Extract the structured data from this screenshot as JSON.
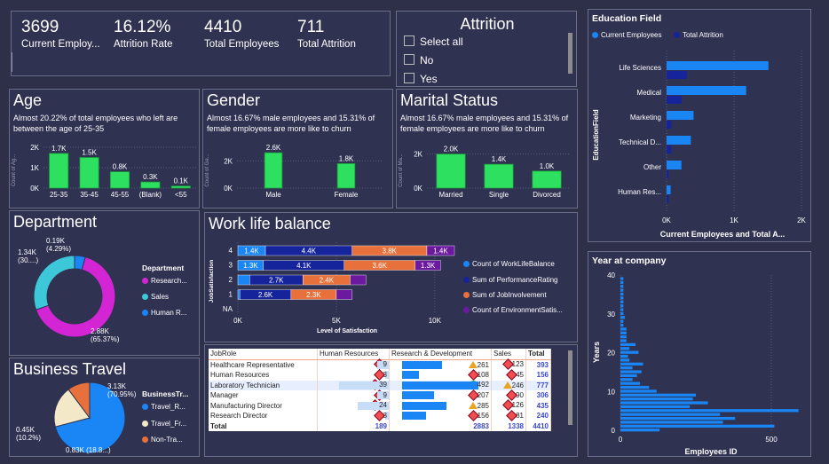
{
  "kpis": [
    {
      "value": "3699",
      "label": "Current Employ..."
    },
    {
      "value": "16.12%",
      "label": "Attrition Rate"
    },
    {
      "value": "4410",
      "label": "Total Employees"
    },
    {
      "value": "711",
      "label": "Total Attrition"
    }
  ],
  "attrition_filter": {
    "title": "Attrition",
    "options": [
      "Select all",
      "No",
      "Yes"
    ]
  },
  "age": {
    "title": "Age",
    "subtitle": "Almost 20.22% of total employees who left are between the age of 25-35",
    "ylabel": "Count of Ag..."
  },
  "gender": {
    "title": "Gender",
    "subtitle": "Almost 16.67% male employees and 15.31% of female employees are more like to churn",
    "ylabel": "Count of Ge..."
  },
  "marital": {
    "title": "Marital Status",
    "subtitle": "Almost 16.67% male employees and 15.31% of female employees are more like to churn",
    "ylabel": "Count of Ma..."
  },
  "department": {
    "title": "Department",
    "legend_title": "Department",
    "legend": [
      "Research...",
      "Sales",
      "Human R..."
    ],
    "labels": [
      "0.19K (4.29%)",
      "1.34K (30....)",
      "2.88K (65.37%)"
    ]
  },
  "travel": {
    "title": "Business Travel",
    "legend_title": "BusinessTr...",
    "legend": [
      "Travel_R...",
      "Travel_Fr...",
      "Non-Tra..."
    ],
    "labels": [
      "3.13K (70.95%)",
      "0.45K (10.2%)",
      "0.83K (18.8...)"
    ]
  },
  "wlb": {
    "title": "Work life balance",
    "ylabel": "JobSatisfaction",
    "xlabel": "Level of Satisfaction",
    "legend": [
      "Count of WorkLifeBalance",
      "Sum of PerformanceRating",
      "Sum of JobInvolvement",
      "Count of EnvironmentSatis..."
    ]
  },
  "education": {
    "title": "Education Field",
    "legend": [
      "Current Employees",
      "Total Attrition"
    ],
    "ylabel": "EducationField",
    "xlabel": "Current Employees and Total A..."
  },
  "years": {
    "title": "Year at company",
    "ylabel": "Years",
    "xlabel": "Employees ID"
  },
  "jobrole": {
    "headers": [
      "JobRole",
      "Human Resources",
      "Research & Development",
      "Sales",
      "Total"
    ],
    "rows": [
      [
        "Healthcare Representative",
        "9",
        "261",
        "123",
        "393"
      ],
      [
        "Human Resources",
        "3",
        "108",
        "45",
        "156"
      ],
      [
        "Laboratory Technician",
        "39",
        "492",
        "246",
        "777"
      ],
      [
        "Manager",
        "9",
        "207",
        "90",
        "306"
      ],
      [
        "Manufacturing Director",
        "24",
        "285",
        "126",
        "435"
      ],
      [
        "Research Director",
        "3",
        "156",
        "81",
        "240"
      ]
    ],
    "total": [
      "Total",
      "189",
      "2883",
      "1338",
      "4410"
    ]
  },
  "colors": {
    "green": "#2ee05f",
    "blue": "#1a85f5",
    "navy": "#15249a",
    "orange": "#e8703a",
    "purple": "#6b1aa0",
    "magenta": "#d425d4",
    "teal": "#3cc8d8",
    "cream": "#f3e9c9"
  },
  "chart_data": [
    {
      "type": "bar",
      "title": "Age",
      "categories": [
        "25-35",
        "35-45",
        "45-55",
        "(Blank)",
        "<55"
      ],
      "values": [
        1.7,
        1.5,
        0.8,
        0.3,
        0.1
      ],
      "labels": [
        "1.7K",
        "1.5K",
        "0.8K",
        "0.3K",
        "0.1K"
      ],
      "ylim": [
        0,
        2
      ],
      "yticks": [
        "0K",
        "1K",
        "2K"
      ]
    },
    {
      "type": "bar",
      "title": "Gender",
      "categories": [
        "Male",
        "Female"
      ],
      "values": [
        2.6,
        1.8
      ],
      "labels": [
        "2.6K",
        "1.8K"
      ],
      "ylim": [
        0,
        3
      ],
      "yticks": [
        "0K",
        "2K"
      ]
    },
    {
      "type": "bar",
      "title": "Marital Status",
      "categories": [
        "Married",
        "Single",
        "Divorced"
      ],
      "values": [
        2.0,
        1.4,
        1.0
      ],
      "labels": [
        "2.0K",
        "1.4K",
        "1.0K"
      ],
      "ylim": [
        0,
        2.4
      ],
      "yticks": [
        "0K",
        "2K"
      ]
    },
    {
      "type": "pie",
      "title": "Department",
      "categories": [
        "Research & Development",
        "Sales",
        "Human Resources"
      ],
      "values": [
        65.37,
        30.34,
        4.29
      ]
    },
    {
      "type": "pie",
      "title": "Business Travel",
      "categories": [
        "Travel_Rarely",
        "Travel_Frequently",
        "Non-Travel"
      ],
      "values": [
        70.95,
        18.85,
        10.2
      ]
    },
    {
      "type": "bar",
      "title": "Work life balance",
      "categories": [
        "4",
        "3",
        "2",
        "1",
        "NA"
      ],
      "xticks": [
        "0K",
        "5K",
        "10K"
      ],
      "xlim": [
        0,
        11
      ],
      "series": [
        {
          "name": "Count of WorkLifeBalance",
          "values": [
            1.4,
            1.3,
            0.6,
            0.1,
            0
          ],
          "labels": [
            "1.4K",
            "1.3K",
            "",
            "",
            ""
          ]
        },
        {
          "name": "Sum of PerformanceRating",
          "values": [
            4.4,
            4.1,
            2.7,
            2.6,
            0
          ],
          "labels": [
            "4.4K",
            "4.1K",
            "2.7K",
            "2.6K",
            ""
          ]
        },
        {
          "name": "Sum of JobInvolvement",
          "values": [
            3.8,
            3.6,
            2.4,
            2.3,
            0
          ],
          "labels": [
            "3.8K",
            "3.6K",
            "2.4K",
            "2.3K",
            ""
          ]
        },
        {
          "name": "Count of EnvironmentSatis...",
          "values": [
            1.4,
            1.3,
            0.8,
            0.8,
            0
          ],
          "labels": [
            "1.4K",
            "1.3K",
            "",
            "",
            ""
          ]
        }
      ]
    },
    {
      "type": "bar",
      "title": "Education Field",
      "categories": [
        "Life Sciences",
        "Medical",
        "Marketing",
        "Technical D...",
        "Other",
        "Human Res..."
      ],
      "xticks": [
        "0K",
        "1K",
        "2K"
      ],
      "xlim": [
        0,
        2
      ],
      "series": [
        {
          "name": "Current Employees",
          "values": [
            1.51,
            1.18,
            0.4,
            0.36,
            0.22,
            0.06
          ]
        },
        {
          "name": "Total Attrition",
          "values": [
            0.3,
            0.22,
            0.07,
            0.07,
            0.03,
            0.03
          ]
        }
      ]
    },
    {
      "type": "bar",
      "title": "Year at company",
      "yticks": [
        "0",
        "10",
        "20",
        "30",
        "40"
      ],
      "xticks": [
        "0",
        "500"
      ],
      "ylim": [
        0,
        40
      ],
      "xlim": [
        0,
        600
      ],
      "values": [
        130,
        510,
        340,
        380,
        330,
        590,
        230,
        290,
        240,
        250,
        120,
        95,
        65,
        40,
        55,
        70,
        40,
        75,
        30,
        25,
        60,
        30,
        50,
        20,
        20,
        20,
        20,
        10,
        10,
        15,
        10,
        10,
        10,
        10,
        10,
        10,
        10,
        10,
        10,
        10
      ]
    }
  ]
}
